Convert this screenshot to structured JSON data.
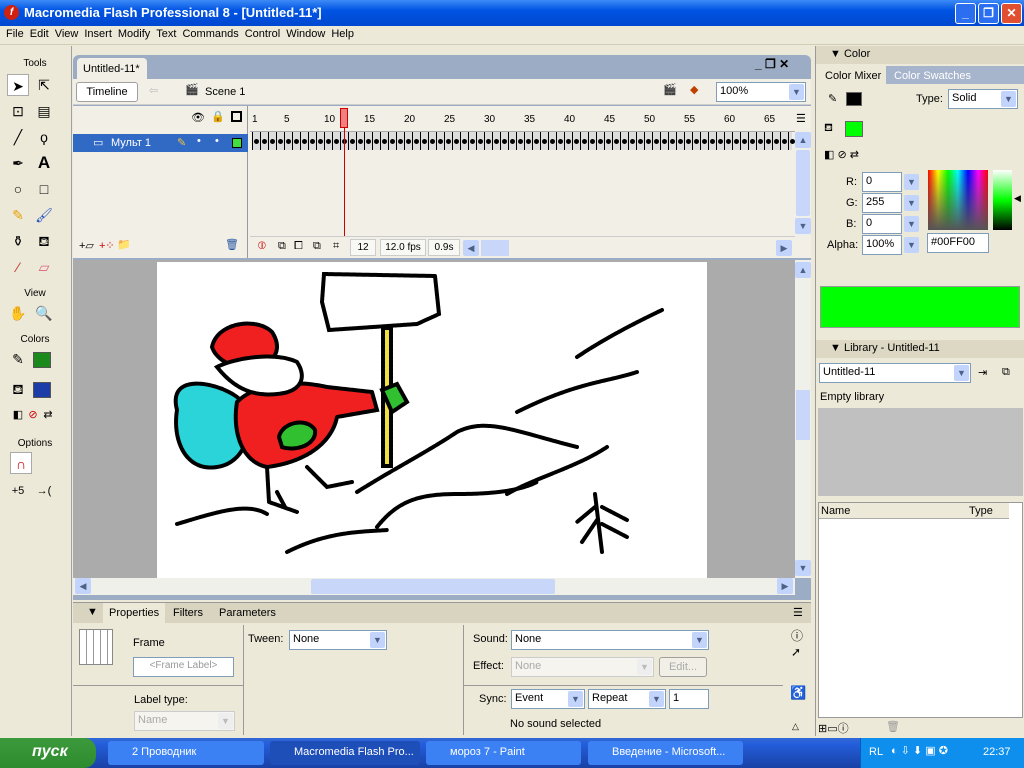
{
  "window": {
    "title": "Macromedia Flash Professional 8 - [Untitled-11*]"
  },
  "menu": [
    "File",
    "Edit",
    "View",
    "Insert",
    "Modify",
    "Text",
    "Commands",
    "Control",
    "Window",
    "Help"
  ],
  "tools": {
    "title": "Tools",
    "view_title": "View",
    "colors_title": "Colors",
    "options_title": "Options"
  },
  "document": {
    "tab": "Untitled-11*",
    "timeline_button": "Timeline",
    "scene": "Scene 1",
    "zoom": "100%"
  },
  "timeline": {
    "ruler": [
      "1",
      "5",
      "10",
      "15",
      "20",
      "25",
      "30",
      "35",
      "40",
      "45",
      "50",
      "55",
      "60",
      "65"
    ],
    "layer": "Мульт 1",
    "current_frame": "12",
    "fps": "12.0 fps",
    "time": "0.9s"
  },
  "properties": {
    "tabs": [
      "Properties",
      "Filters",
      "Parameters"
    ],
    "frame_label": "Frame",
    "frame_placeholder": "<Frame Label>",
    "label_type": "Label type:",
    "label_type_value": "Name",
    "tween_label": "Tween:",
    "tween_value": "None",
    "sound_label": "Sound:",
    "sound_value": "None",
    "effect_label": "Effect:",
    "effect_value": "None",
    "edit_button": "Edit...",
    "sync_label": "Sync:",
    "sync_value": "Event",
    "repeat_value": "Repeat",
    "repeat_count": "1",
    "status": "No sound selected"
  },
  "color_panel": {
    "title": "Color",
    "tabs": [
      "Color Mixer",
      "Color Swatches"
    ],
    "type_label": "Type:",
    "type_value": "Solid",
    "r_label": "R:",
    "r": "0",
    "g_label": "G:",
    "g": "255",
    "b_label": "B:",
    "b": "0",
    "alpha_label": "Alpha:",
    "alpha": "100%",
    "hex": "#00FF00",
    "stroke_color": "#000000",
    "fill_color": "#00FF00"
  },
  "library": {
    "title": "Library - Untitled-11",
    "selected": "Untitled-11",
    "empty": "Empty library",
    "col_name": "Name",
    "col_type": "Type"
  },
  "taskbar": {
    "start": "пуск",
    "tasks": [
      "2 Проводник",
      "Macromedia Flash Pro...",
      "мороз 7 - Paint",
      "Введение - Microsoft..."
    ],
    "lang": "RL",
    "clock": "22:37"
  }
}
